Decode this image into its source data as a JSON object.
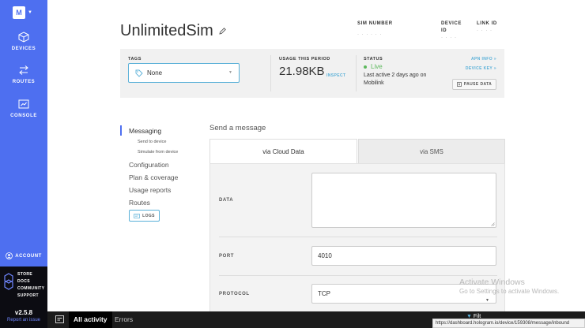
{
  "sidebar": {
    "org_initial": "M",
    "nav": [
      {
        "label": "DEVICES",
        "icon": "cube-icon"
      },
      {
        "label": "ROUTES",
        "icon": "routes-icon"
      },
      {
        "label": "CONSOLE",
        "icon": "console-icon"
      }
    ],
    "account_label": "ACCOUNT",
    "links": [
      "STORE",
      "DOCS",
      "COMMUNITY",
      "SUPPORT"
    ],
    "version": "v2.5.8",
    "report_link": "Report an issue"
  },
  "header": {
    "device_name": "UnlimitedSim",
    "sim_number_label": "SIM NUMBER",
    "sim_number_value": "· · ·              · · ·",
    "device_id_label": "DEVICE ID",
    "device_id_value": "· · · ·",
    "link_id_label": "LINK ID",
    "link_id_value": "· · · ·"
  },
  "info_card": {
    "tags_label": "TAGS",
    "tags_value": "None",
    "usage_label": "USAGE THIS PERIOD",
    "usage_value": "21.98KB",
    "inspect_label": "INSPECT",
    "status_label": "STATUS",
    "status_value": "Live",
    "status_detail": "Last active 2 days ago on Mobilink",
    "apn_info": "APN INFO »",
    "device_key": "DEVICE KEY »",
    "pause_label": "PAUSE DATA"
  },
  "subnav": {
    "messaging": "Messaging",
    "send_to_device": "Send to device",
    "simulate_from_device": "Simulate from device",
    "configuration": "Configuration",
    "plan_coverage": "Plan & coverage",
    "usage_reports": "Usage reports",
    "routes": "Routes",
    "logs": "LOGS"
  },
  "message": {
    "title": "Send a message",
    "tab_cloud": "via Cloud Data",
    "tab_sms": "via SMS",
    "data_label": "DATA",
    "data_value": "",
    "port_label": "PORT",
    "port_value": "4010",
    "protocol_label": "PROTOCOL",
    "protocol_value": "TCP"
  },
  "activity_bar": {
    "all_activity": "All activity",
    "errors": "Errors",
    "filter_label": "Filt"
  },
  "watermark": {
    "title": "Activate Windows",
    "subtitle": "Go to Settings to activate Windows."
  },
  "status_url": "https://dashboard.hologram.io/device/159308/message/inbound"
}
